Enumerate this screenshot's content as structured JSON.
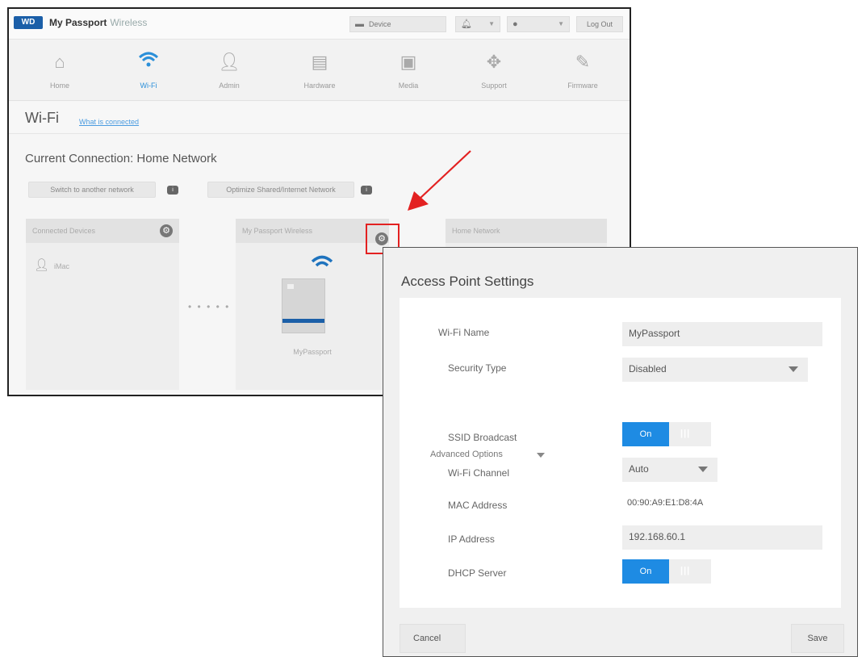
{
  "app": {
    "logo_text": "WD",
    "brand_name": "My Passport",
    "brand_sub": "Wireless"
  },
  "topbar": {
    "device_label": "Device",
    "logout_label": "Log Out"
  },
  "nav": {
    "items": [
      {
        "label": "Home",
        "icon": "home-icon"
      },
      {
        "label": "Wi-Fi",
        "icon": "wifi-icon"
      },
      {
        "label": "Admin",
        "icon": "admin-icon"
      },
      {
        "label": "Hardware",
        "icon": "hardware-icon"
      },
      {
        "label": "Media",
        "icon": "media-icon"
      },
      {
        "label": "Support",
        "icon": "support-icon"
      },
      {
        "label": "Firmware",
        "icon": "firmware-icon"
      }
    ]
  },
  "page": {
    "title": "Wi-Fi",
    "link": "What is connected",
    "connection_title": "Current Connection: Home Network",
    "switch_button": "Switch to another network",
    "optimize_button": "Optimize Shared/Internet Network"
  },
  "panels": {
    "clients": {
      "title": "Connected Devices",
      "client": "iMac"
    },
    "passport": {
      "title": "My Passport Wireless",
      "device_label": "MyPassport"
    },
    "home": {
      "title": "Home Network"
    }
  },
  "modal": {
    "title": "Access Point Settings",
    "fields": {
      "wifi_name_label": "Wi-Fi Name",
      "wifi_name_value": "MyPassport",
      "security_label": "Security Type",
      "security_value": "Disabled",
      "advanced_label": "Advanced Options",
      "ssid_label": "SSID Broadcast",
      "ssid_toggle": "On",
      "channel_label": "Wi-Fi Channel",
      "channel_value": "Auto",
      "mac_label": "MAC Address",
      "mac_value": "00:90:A9:E1:D8:4A",
      "ip_label": "IP Address",
      "ip_value": "192.168.60.1",
      "dhcp_label": "DHCP Server",
      "dhcp_toggle": "On"
    },
    "cancel_label": "Cancel",
    "save_label": "Save"
  },
  "colors": {
    "accent": "#1e8be3",
    "highlight": "#e32121",
    "brand": "#1b5fa8"
  }
}
